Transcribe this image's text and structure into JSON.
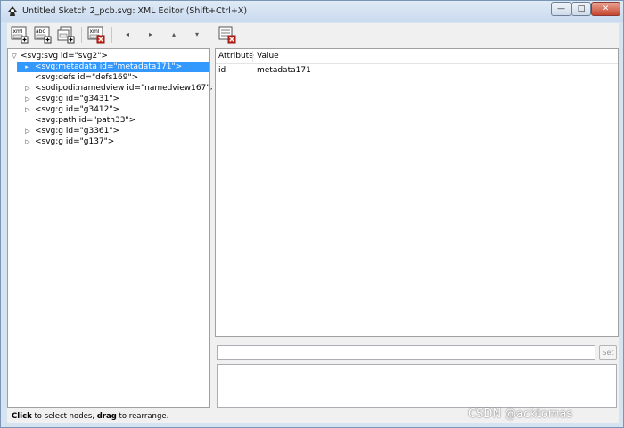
{
  "window": {
    "title": "Untitled Sketch 2_pcb.svg: XML Editor (Shift+Ctrl+X)",
    "minimize_glyph": "—",
    "maximize_glyph": "□",
    "close_glyph": "✕"
  },
  "toolbar": {
    "new_element_icon_text": "xml",
    "new_text_icon_text": "abc",
    "delete_icon_text": "xml",
    "nav": [
      "◂",
      "▸",
      "▴",
      "▾"
    ]
  },
  "tree": {
    "nodes": [
      {
        "toggle": "▽",
        "text": "<svg:svg id=\"svg2\">"
      },
      {
        "toggle": "▸",
        "text": "<svg:metadata id=\"metadata171\">",
        "selected": true
      },
      {
        "toggle": "",
        "text": "<svg:defs id=\"defs169\">"
      },
      {
        "toggle": "▷",
        "text": "<sodipodi:namedview id=\"namedview167\">"
      },
      {
        "toggle": "▷",
        "text": "<svg:g id=\"g3431\">"
      },
      {
        "toggle": "▷",
        "text": "<svg:g id=\"g3412\">"
      },
      {
        "toggle": "",
        "text": "<svg:path id=\"path33\">"
      },
      {
        "toggle": "▷",
        "text": "<svg:g id=\"g3361\">"
      },
      {
        "toggle": "▷",
        "text": "<svg:g id=\"g137\">"
      }
    ]
  },
  "attributes": {
    "headers": {
      "attribute": "Attribute",
      "value": "Value"
    },
    "rows": [
      {
        "name": "id",
        "value": "metadata171"
      }
    ]
  },
  "editor": {
    "value_input": "",
    "set_label": "Set",
    "value_text": ""
  },
  "status": {
    "click": "Click",
    "select_text": " to select nodes, ",
    "drag": "drag",
    "rearrange_text": " to rearrange."
  },
  "watermark": "CSDN @acktomas",
  "colors": {
    "selection": "#3399ff",
    "title_bar": "#c9daee",
    "close_button": "#c7462f"
  }
}
